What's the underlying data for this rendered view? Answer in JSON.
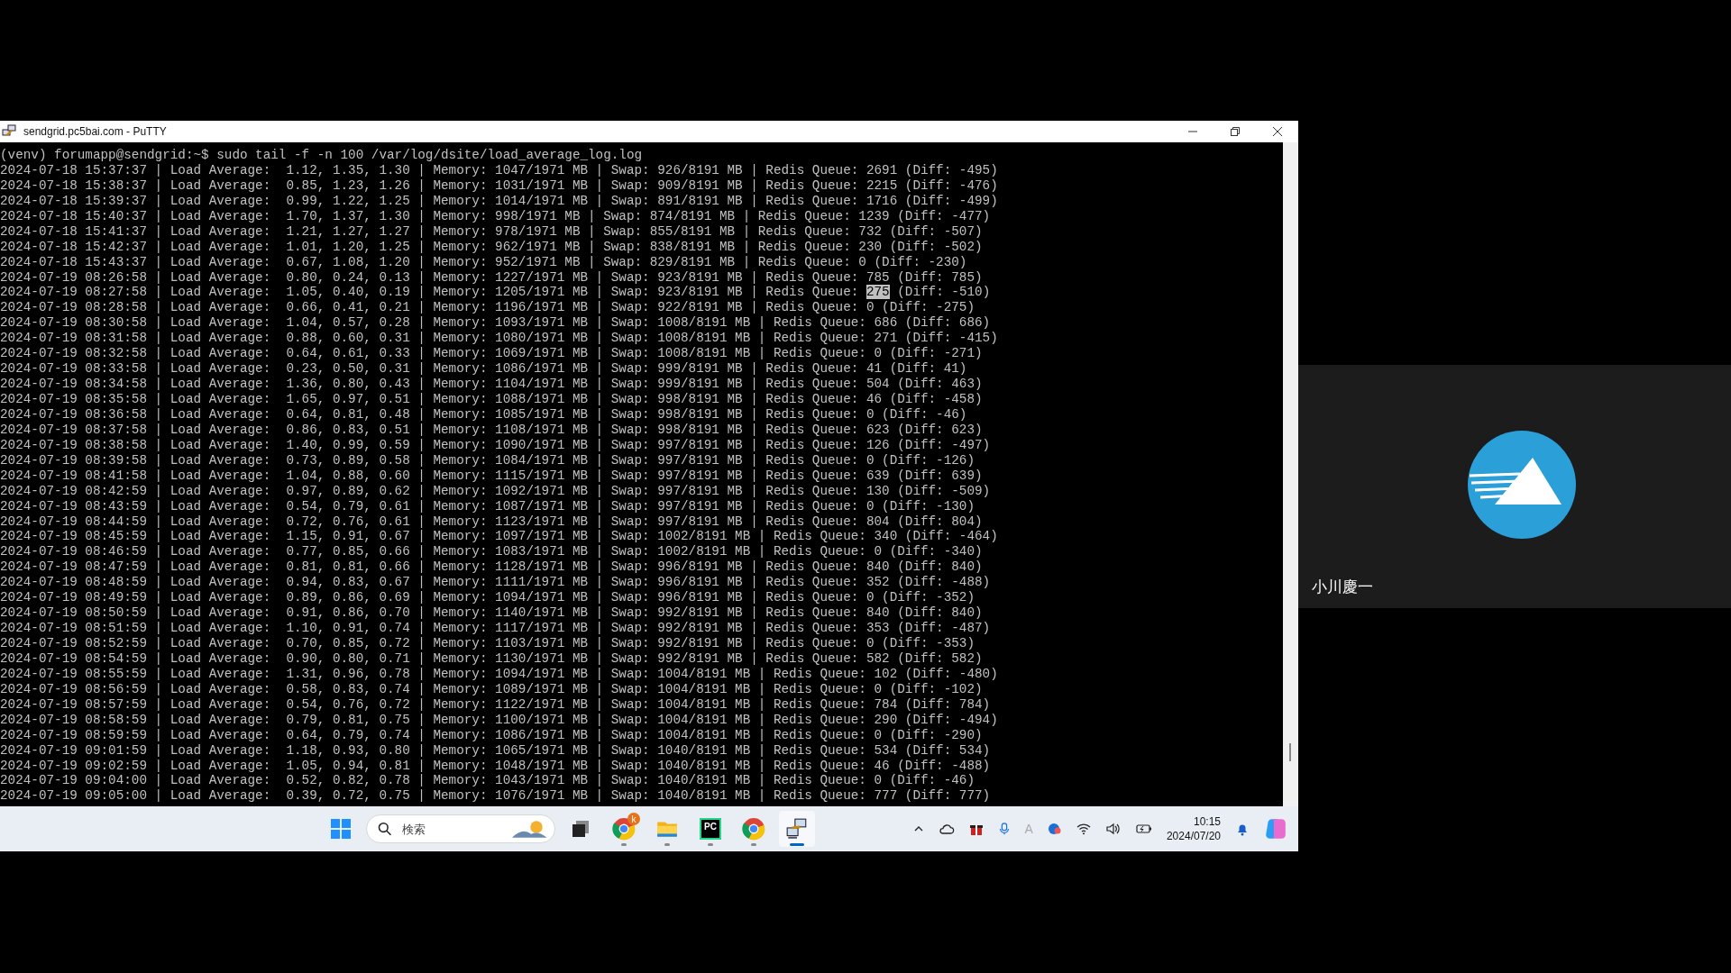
{
  "window": {
    "title": "sendgrid.pc5bai.com - PuTTY"
  },
  "terminal": {
    "lines": [
      {
        "text": "(venv) forumapp@sendgrid:~$ sudo tail -f -n 100 /var/log/dsite/load_average_log.log"
      },
      {
        "text": "2024-07-18 15:37:37 | Load Average:  1.12, 1.35, 1.30 | Memory: 1047/1971 MB | Swap: 926/8191 MB | Redis Queue: 2691 (Diff: -495)"
      },
      {
        "text": "2024-07-18 15:38:37 | Load Average:  0.85, 1.23, 1.26 | Memory: 1031/1971 MB | Swap: 909/8191 MB | Redis Queue: 2215 (Diff: -476)"
      },
      {
        "text": "2024-07-18 15:39:37 | Load Average:  0.99, 1.22, 1.25 | Memory: 1014/1971 MB | Swap: 891/8191 MB | Redis Queue: 1716 (Diff: -499)"
      },
      {
        "text": "2024-07-18 15:40:37 | Load Average:  1.70, 1.37, 1.30 | Memory: 998/1971 MB | Swap: 874/8191 MB | Redis Queue: 1239 (Diff: -477)"
      },
      {
        "text": "2024-07-18 15:41:37 | Load Average:  1.21, 1.27, 1.27 | Memory: 978/1971 MB | Swap: 855/8191 MB | Redis Queue: 732 (Diff: -507)"
      },
      {
        "text": "2024-07-18 15:42:37 | Load Average:  1.01, 1.20, 1.25 | Memory: 962/1971 MB | Swap: 838/8191 MB | Redis Queue: 230 (Diff: -502)"
      },
      {
        "text": "2024-07-18 15:43:37 | Load Average:  0.67, 1.08, 1.20 | Memory: 952/1971 MB | Swap: 829/8191 MB | Redis Queue: 0 (Diff: -230)"
      },
      {
        "text": "2024-07-19 08:26:58 | Load Average:  0.80, 0.24, 0.13 | Memory: 1227/1971 MB | Swap: 923/8191 MB | Redis Queue: 785 (Diff: 785)"
      },
      {
        "text": "2024-07-19 08:27:58 | Load Average:  1.05, 0.40, 0.19 | Memory: 1205/1971 MB | Swap: 923/8191 MB | Redis Queue: ",
        "selection": "275",
        "rest": " (Diff: -510)"
      },
      {
        "text": "2024-07-19 08:28:58 | Load Average:  0.66, 0.41, 0.21 | Memory: 1196/1971 MB | Swap: 922/8191 MB | Redis Queue: 0 (Diff: -275)"
      },
      {
        "text": "2024-07-19 08:30:58 | Load Average:  1.04, 0.57, 0.28 | Memory: 1093/1971 MB | Swap: 1008/8191 MB | Redis Queue: 686 (Diff: 686)"
      },
      {
        "text": "2024-07-19 08:31:58 | Load Average:  0.88, 0.60, 0.31 | Memory: 1080/1971 MB | Swap: 1008/8191 MB | Redis Queue: 271 (Diff: -415)"
      },
      {
        "text": "2024-07-19 08:32:58 | Load Average:  0.64, 0.61, 0.33 | Memory: 1069/1971 MB | Swap: 1008/8191 MB | Redis Queue: 0 (Diff: -271)"
      },
      {
        "text": "2024-07-19 08:33:58 | Load Average:  0.23, 0.50, 0.31 | Memory: 1086/1971 MB | Swap: 999/8191 MB | Redis Queue: 41 (Diff: 41)"
      },
      {
        "text": "2024-07-19 08:34:58 | Load Average:  1.36, 0.80, 0.43 | Memory: 1104/1971 MB | Swap: 999/8191 MB | Redis Queue: 504 (Diff: 463)"
      },
      {
        "text": "2024-07-19 08:35:58 | Load Average:  1.65, 0.97, 0.51 | Memory: 1088/1971 MB | Swap: 998/8191 MB | Redis Queue: 46 (Diff: -458)"
      },
      {
        "text": "2024-07-19 08:36:58 | Load Average:  0.64, 0.81, 0.48 | Memory: 1085/1971 MB | Swap: 998/8191 MB | Redis Queue: 0 (Diff: -46)"
      },
      {
        "text": "2024-07-19 08:37:58 | Load Average:  0.86, 0.83, 0.51 | Memory: 1108/1971 MB | Swap: 998/8191 MB | Redis Queue: 623 (Diff: 623)"
      },
      {
        "text": "2024-07-19 08:38:58 | Load Average:  1.40, 0.99, 0.59 | Memory: 1090/1971 MB | Swap: 997/8191 MB | Redis Queue: 126 (Diff: -497)"
      },
      {
        "text": "2024-07-19 08:39:58 | Load Average:  0.73, 0.89, 0.58 | Memory: 1084/1971 MB | Swap: 997/8191 MB | Redis Queue: 0 (Diff: -126)"
      },
      {
        "text": "2024-07-19 08:41:58 | Load Average:  1.04, 0.88, 0.60 | Memory: 1115/1971 MB | Swap: 997/8191 MB | Redis Queue: 639 (Diff: 639)"
      },
      {
        "text": "2024-07-19 08:42:59 | Load Average:  0.97, 0.89, 0.62 | Memory: 1092/1971 MB | Swap: 997/8191 MB | Redis Queue: 130 (Diff: -509)"
      },
      {
        "text": "2024-07-19 08:43:59 | Load Average:  0.54, 0.79, 0.61 | Memory: 1087/1971 MB | Swap: 997/8191 MB | Redis Queue: 0 (Diff: -130)"
      },
      {
        "text": "2024-07-19 08:44:59 | Load Average:  0.72, 0.76, 0.61 | Memory: 1123/1971 MB | Swap: 997/8191 MB | Redis Queue: 804 (Diff: 804)"
      },
      {
        "text": "2024-07-19 08:45:59 | Load Average:  1.15, 0.91, 0.67 | Memory: 1097/1971 MB | Swap: 1002/8191 MB | Redis Queue: 340 (Diff: -464)"
      },
      {
        "text": "2024-07-19 08:46:59 | Load Average:  0.77, 0.85, 0.66 | Memory: 1083/1971 MB | Swap: 1002/8191 MB | Redis Queue: 0 (Diff: -340)"
      },
      {
        "text": "2024-07-19 08:47:59 | Load Average:  0.81, 0.81, 0.66 | Memory: 1128/1971 MB | Swap: 996/8191 MB | Redis Queue: 840 (Diff: 840)"
      },
      {
        "text": "2024-07-19 08:48:59 | Load Average:  0.94, 0.83, 0.67 | Memory: 1111/1971 MB | Swap: 996/8191 MB | Redis Queue: 352 (Diff: -488)"
      },
      {
        "text": "2024-07-19 08:49:59 | Load Average:  0.89, 0.86, 0.69 | Memory: 1094/1971 MB | Swap: 996/8191 MB | Redis Queue: 0 (Diff: -352)"
      },
      {
        "text": "2024-07-19 08:50:59 | Load Average:  0.91, 0.86, 0.70 | Memory: 1140/1971 MB | Swap: 992/8191 MB | Redis Queue: 840 (Diff: 840)"
      },
      {
        "text": "2024-07-19 08:51:59 | Load Average:  1.10, 0.91, 0.74 | Memory: 1117/1971 MB | Swap: 992/8191 MB | Redis Queue: 353 (Diff: -487)"
      },
      {
        "text": "2024-07-19 08:52:59 | Load Average:  0.70, 0.85, 0.72 | Memory: 1103/1971 MB | Swap: 992/8191 MB | Redis Queue: 0 (Diff: -353)"
      },
      {
        "text": "2024-07-19 08:54:59 | Load Average:  0.90, 0.80, 0.71 | Memory: 1130/1971 MB | Swap: 992/8191 MB | Redis Queue: 582 (Diff: 582)"
      },
      {
        "text": "2024-07-19 08:55:59 | Load Average:  1.31, 0.96, 0.78 | Memory: 1094/1971 MB | Swap: 1004/8191 MB | Redis Queue: 102 (Diff: -480)"
      },
      {
        "text": "2024-07-19 08:56:59 | Load Average:  0.58, 0.83, 0.74 | Memory: 1089/1971 MB | Swap: 1004/8191 MB | Redis Queue: 0 (Diff: -102)"
      },
      {
        "text": "2024-07-19 08:57:59 | Load Average:  0.54, 0.76, 0.72 | Memory: 1122/1971 MB | Swap: 1004/8191 MB | Redis Queue: 784 (Diff: 784)"
      },
      {
        "text": "2024-07-19 08:58:59 | Load Average:  0.79, 0.81, 0.75 | Memory: 1100/1971 MB | Swap: 1004/8191 MB | Redis Queue: 290 (Diff: -494)"
      },
      {
        "text": "2024-07-19 08:59:59 | Load Average:  0.64, 0.79, 0.74 | Memory: 1086/1971 MB | Swap: 1004/8191 MB | Redis Queue: 0 (Diff: -290)"
      },
      {
        "text": "2024-07-19 09:01:59 | Load Average:  1.18, 0.93, 0.80 | Memory: 1065/1971 MB | Swap: 1040/8191 MB | Redis Queue: 534 (Diff: 534)"
      },
      {
        "text": "2024-07-19 09:02:59 | Load Average:  1.05, 0.94, 0.81 | Memory: 1048/1971 MB | Swap: 1040/8191 MB | Redis Queue: 46 (Diff: -488)"
      },
      {
        "text": "2024-07-19 09:04:00 | Load Average:  0.52, 0.82, 0.78 | Memory: 1043/1971 MB | Swap: 1040/8191 MB | Redis Queue: 0 (Diff: -46)"
      },
      {
        "text": "2024-07-19 09:05:00 | Load Average:  0.39, 0.72, 0.75 | Memory: 1076/1971 MB | Swap: 1040/8191 MB | Redis Queue: 777 (Diff: 777)"
      }
    ]
  },
  "taskbar": {
    "search": {
      "placeholder": "検索"
    },
    "apps": [
      {
        "kind": "taskview",
        "active": false
      },
      {
        "kind": "chrome",
        "badge": "k",
        "active": false
      },
      {
        "kind": "files",
        "active": false
      },
      {
        "kind": "pycharm",
        "label": "PC",
        "active": false
      },
      {
        "kind": "chrome",
        "active": false
      },
      {
        "kind": "putty",
        "active": true
      }
    ],
    "ime": "A",
    "time": "10:15",
    "date": "2024/07/20"
  },
  "participant": {
    "name": "小川慶一"
  }
}
